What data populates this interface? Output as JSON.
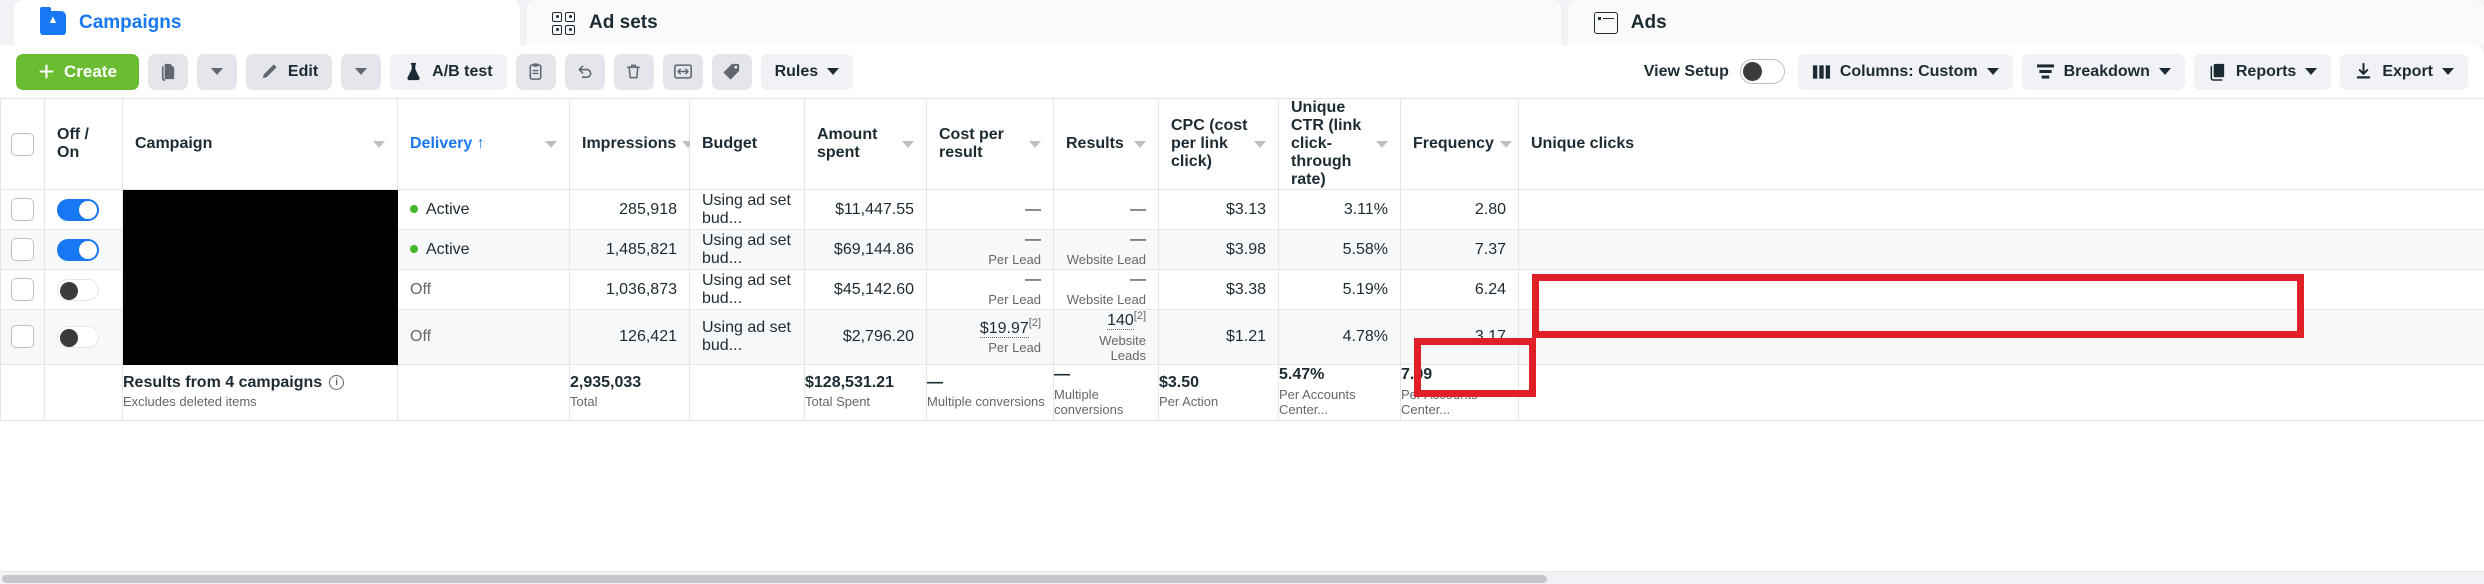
{
  "tabs": [
    {
      "label": "Campaigns",
      "icon": "campaigns-folder-icon",
      "active": true
    },
    {
      "label": "Ad sets",
      "icon": "adsets-grid-icon",
      "active": false
    },
    {
      "label": "Ads",
      "icon": "ads-card-icon",
      "active": false
    }
  ],
  "toolbar": {
    "create_label": "Create",
    "duplicate_icon": "duplicate-icon",
    "duplicate_caret": "chevron-down-icon",
    "edit_label": "Edit",
    "edit_icon": "pencil-icon",
    "edit_caret": "chevron-down-icon",
    "abtest_label": "A/B test",
    "abtest_icon": "flask-icon",
    "clipboard_icon": "clipboard-icon",
    "undo_icon": "undo-arrow-icon",
    "delete_icon": "trash-icon",
    "export_preview_icon": "resize-arrows-icon",
    "tag_icon": "tag-icon",
    "rules_label": "Rules",
    "view_setup_label": "View Setup",
    "view_setup_toggle": "off",
    "columns_label": "Columns: Custom",
    "columns_icon": "columns-icon",
    "breakdown_label": "Breakdown",
    "breakdown_icon": "breakdown-icon",
    "reports_label": "Reports",
    "reports_icon": "reports-icon",
    "export_label": "Export",
    "export_icon": "download-icon",
    "accent_green": "#6abd31",
    "accent_blue": "#1877f2",
    "highlight_red": "#e01f26"
  },
  "table": {
    "columns": [
      {
        "label": "",
        "name": "select-all"
      },
      {
        "label": "Off / On",
        "name": "off-on"
      },
      {
        "label": "Campaign",
        "name": "campaign",
        "sortable": true
      },
      {
        "label": "Delivery",
        "name": "delivery",
        "sortable": true,
        "sorted": "↑",
        "link": true
      },
      {
        "label": "Impressions",
        "name": "impressions",
        "sortable": true,
        "numeric": true
      },
      {
        "label": "Budget",
        "name": "budget"
      },
      {
        "label": "Amount spent",
        "name": "amount-spent",
        "sortable": true,
        "numeric": true
      },
      {
        "label": "Cost per result",
        "name": "cost-per-result",
        "sortable": true,
        "numeric": true
      },
      {
        "label": "Results",
        "name": "results",
        "sortable": true,
        "numeric": true
      },
      {
        "label": "CPC (cost per link click)",
        "name": "cpc",
        "sortable": true,
        "numeric": true
      },
      {
        "label": "Unique CTR (link click-through rate)",
        "name": "unique-ctr",
        "sortable": true,
        "numeric": true
      },
      {
        "label": "Frequency",
        "name": "frequency",
        "sortable": true,
        "numeric": true
      },
      {
        "label": "Unique clicks",
        "name": "unique-clicks",
        "numeric": true
      }
    ],
    "rows": [
      {
        "toggle": "on",
        "campaign": "",
        "delivery": "Active",
        "delivery_state": "active",
        "impressions": "285,918",
        "budget": "Using ad set bud...",
        "amount_spent": "$11,447.55",
        "cost_per_result": "—",
        "cost_per_result_sub": "",
        "results": "—",
        "results_sub": "",
        "cpc": "$3.13",
        "unique_ctr": "3.11%",
        "frequency": "2.80",
        "unique_clicks": ""
      },
      {
        "toggle": "on",
        "campaign": "",
        "delivery": "Active",
        "delivery_state": "active",
        "impressions": "1,485,821",
        "budget": "Using ad set bud...",
        "amount_spent": "$69,144.86",
        "cost_per_result": "—",
        "cost_per_result_sub": "Per Lead",
        "results": "—",
        "results_sub": "Website Lead",
        "cpc": "$3.98",
        "unique_ctr": "5.58%",
        "frequency": "7.37",
        "unique_clicks": ""
      },
      {
        "toggle": "off",
        "campaign": "",
        "delivery": "Off",
        "delivery_state": "off",
        "impressions": "1,036,873",
        "budget": "Using ad set bud...",
        "amount_spent": "$45,142.60",
        "cost_per_result": "—",
        "cost_per_result_sub": "Per Lead",
        "results": "—",
        "results_sub": "Website Lead",
        "cpc": "$3.38",
        "unique_ctr": "5.19%",
        "frequency": "6.24",
        "unique_clicks": ""
      },
      {
        "toggle": "off",
        "campaign": "",
        "delivery": "Off",
        "delivery_state": "off",
        "impressions": "126,421",
        "budget": "Using ad set bud...",
        "amount_spent": "$2,796.20",
        "cost_per_result": "$19.97",
        "cost_per_result_sup": "[2]",
        "cost_per_result_sub": "Per Lead",
        "results": "140",
        "results_sup": "[2]",
        "results_sub": "Website Leads",
        "cpc": "$1.21",
        "unique_ctr": "4.78%",
        "frequency": "3.17",
        "unique_clicks": ""
      }
    ],
    "summary": {
      "title": "Results from 4 campaigns",
      "subtitle": "Excludes deleted items",
      "info_icon": "info-icon",
      "impressions": "2,935,033",
      "impressions_sub": "Total",
      "amount_spent": "$128,531.21",
      "amount_spent_sub": "Total Spent",
      "cost_per_result": "—",
      "cost_per_result_sub": "Multiple conversions",
      "results": "—",
      "results_sub": "Multiple conversions",
      "cpc": "$3.50",
      "cpc_sub": "Per Action",
      "unique_ctr": "5.47%",
      "unique_ctr_sub": "Per Accounts Center...",
      "frequency": "7.09",
      "frequency_sub": "Per Accounts Center...",
      "unique_clicks": ""
    }
  }
}
